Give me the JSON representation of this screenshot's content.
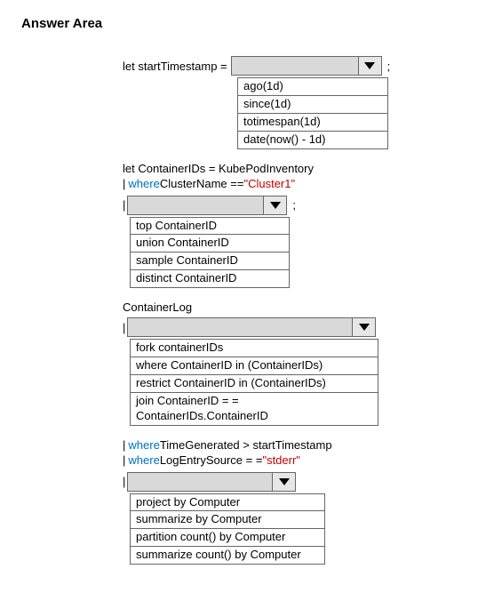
{
  "title": "Answer Area",
  "block1": {
    "prefix": "let startTimestamp = ",
    "semicolon": ";",
    "options": [
      "ago(1d)",
      "since(1d)",
      "totimespan(1d)",
      "date(now() - 1d)"
    ]
  },
  "block2": {
    "line1_let": "let ContainerIDs = KubePodInventory",
    "line2_pipe": "| ",
    "line2_where": "where",
    "line2_mid": " ClusterName == ",
    "line2_val": "\"Cluster1\"",
    "line3_pipe": "|",
    "semicolon": ";",
    "options": [
      "top ContainerID",
      "union ContainerID",
      "sample ContainerID",
      "distinct ContainerID"
    ]
  },
  "block3": {
    "header": "ContainerLog",
    "line_pipe": "|",
    "options": [
      "fork containerIDs",
      "where ContainerID in (ContainerIDs)",
      "restrict ContainerID in (ContainerIDs)",
      "join ContainerID = = ContainerIDs.ContainerID"
    ]
  },
  "block4": {
    "line1_pipe": "| ",
    "line1_where": "where",
    "line1_rest": " TimeGenerated > startTimestamp",
    "line2_pipe": "| ",
    "line2_where": "where",
    "line2_mid": " LogEntrySource = = ",
    "line2_val": "\"stderr\"",
    "line3_pipe": "|",
    "options": [
      "project by Computer",
      "summarize by Computer",
      "partition count() by Computer",
      "summarize count() by Computer"
    ]
  }
}
